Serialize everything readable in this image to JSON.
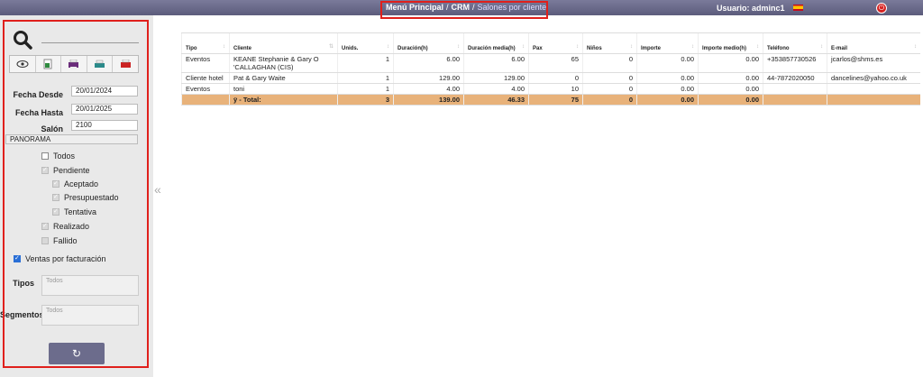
{
  "header": {
    "breadcrumb": [
      "Menú Principal",
      "CRM",
      "Salones por cliente"
    ],
    "breadcrumb_sep": "/",
    "user": "Usuario: adminc1"
  },
  "sidebar": {
    "fecha_desde_label": "Fecha Desde",
    "fecha_desde": "20/01/2024",
    "fecha_hasta_label": "Fecha Hasta",
    "fecha_hasta": "20/01/2025",
    "salon_label": "Salón",
    "salon": "2100",
    "salon_name": "PANORAMA",
    "checks": {
      "todos": "Todos",
      "pendiente": "Pendiente",
      "aceptado": "Aceptado",
      "presupuestado": "Presupuestado",
      "tentativa": "Tentativa",
      "realizado": "Realizado",
      "fallido": "Fallido",
      "ventas": "Ventas por facturación"
    },
    "tipos_label": "Tipos",
    "tipos_placeholder": "Todos",
    "segmentos_label": "Segmentos",
    "segmentos_placeholder": "Todos",
    "refresh_icon": "↻"
  },
  "table": {
    "headers": [
      "Tipo",
      "Cliente",
      "Unids.",
      "Duración(h)",
      "Duración media(h)",
      "Pax",
      "Niños",
      "Importe",
      "Importe medio(h)",
      "Teléfono",
      "E-mail"
    ],
    "rows": [
      [
        "Eventos",
        "KEANE Stephanie & Gary O 'CALLAGHAN (CIS)",
        "1",
        "6.00",
        "6.00",
        "65",
        "0",
        "0.00",
        "0.00",
        "+353857730526",
        "jcarlos@shms.es"
      ],
      [
        "Cliente hotel",
        "Pat & Gary Waite",
        "1",
        "129.00",
        "129.00",
        "0",
        "0",
        "0.00",
        "0.00",
        "44-7872020050",
        "dancelines@yahoo.co.uk"
      ],
      [
        "Eventos",
        "toni",
        "1",
        "4.00",
        "4.00",
        "10",
        "0",
        "0.00",
        "0.00",
        "",
        ""
      ]
    ],
    "total": [
      "",
      "ÿ - Total:",
      "3",
      "139.00",
      "46.33",
      "75",
      "0",
      "0.00",
      "0.00",
      "",
      ""
    ]
  }
}
